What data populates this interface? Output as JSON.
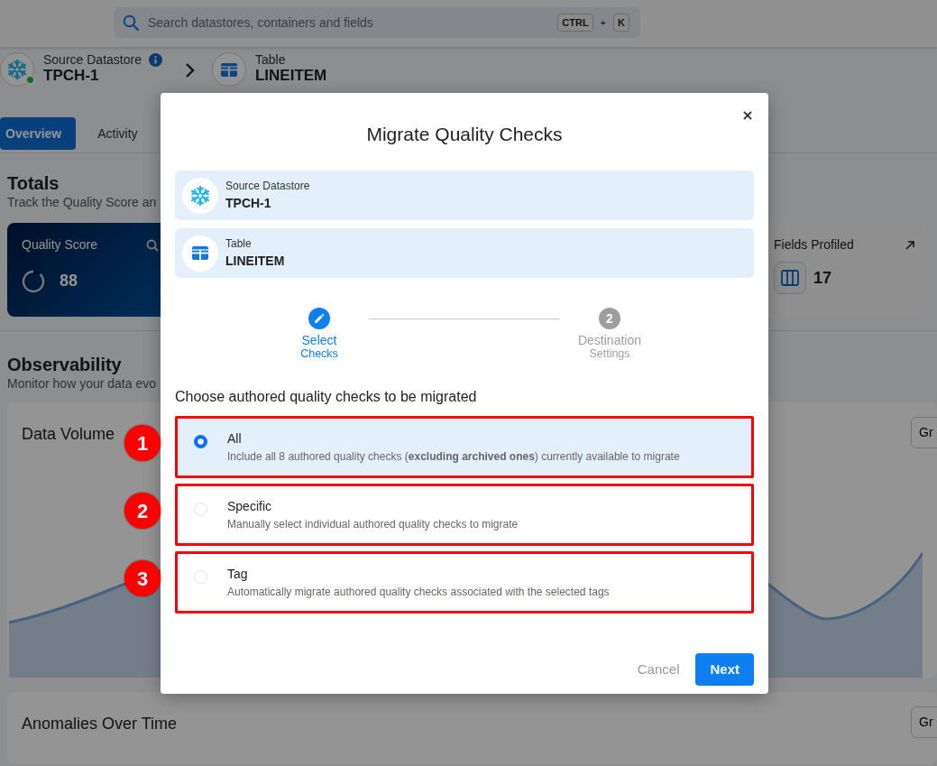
{
  "search": {
    "placeholder": "Search datastores, containers and fields",
    "shortcut": [
      "CTRL",
      "+",
      "K"
    ]
  },
  "breadcrumb": [
    {
      "kind": "datastore",
      "label": "Source Datastore",
      "value": "TPCH-1",
      "online": true,
      "info": true
    },
    {
      "kind": "table",
      "label": "Table",
      "value": "LINEITEM"
    }
  ],
  "tabs": [
    {
      "label": "Overview",
      "selected": true
    },
    {
      "label": "Activity",
      "selected": false
    }
  ],
  "totals": {
    "title": "Totals",
    "subtitle": "Track the Quality Score an",
    "cards": [
      {
        "kind": "score",
        "label": "Quality Score",
        "value": "88",
        "level": 0.88
      },
      {
        "kind": "fields",
        "label": "Fields Profiled",
        "value": "17"
      }
    ]
  },
  "observability": {
    "title": "Observability",
    "subtitle": "Monitor how your data evo",
    "panels": [
      {
        "title": "Data Volume",
        "button": "Gr",
        "chart": true
      },
      {
        "title": "Anomalies Over Time",
        "button": "Gr",
        "chart": false
      }
    ]
  },
  "modal": {
    "title": "Migrate Quality Checks",
    "sources": [
      {
        "kind": "datastore",
        "label": "Source Datastore",
        "value": "TPCH-1"
      },
      {
        "kind": "table",
        "label": "Table",
        "value": "LINEITEM"
      }
    ],
    "steps": [
      {
        "title": "Select",
        "subtitle": "Checks",
        "active": true
      },
      {
        "title": "Destination",
        "subtitle": "Settings",
        "active": false,
        "number": "2"
      }
    ],
    "prompt": "Choose authored quality checks to be migrated",
    "options": [
      {
        "label": "All",
        "description": "Include all 8 authored quality checks (**excluding archived ones**) currently available to migrate",
        "selected": true,
        "callout": "1"
      },
      {
        "label": "Specific",
        "description": "Manually select individual authored quality checks to migrate",
        "selected": false,
        "callout": "2"
      },
      {
        "label": "Tag",
        "description": "Automatically migrate authored quality checks associated with the selected tags",
        "selected": false,
        "callout": "3"
      }
    ],
    "buttons": [
      {
        "kind": "secondary",
        "label": "Cancel"
      },
      {
        "kind": "primary",
        "label": "Next"
      }
    ]
  }
}
